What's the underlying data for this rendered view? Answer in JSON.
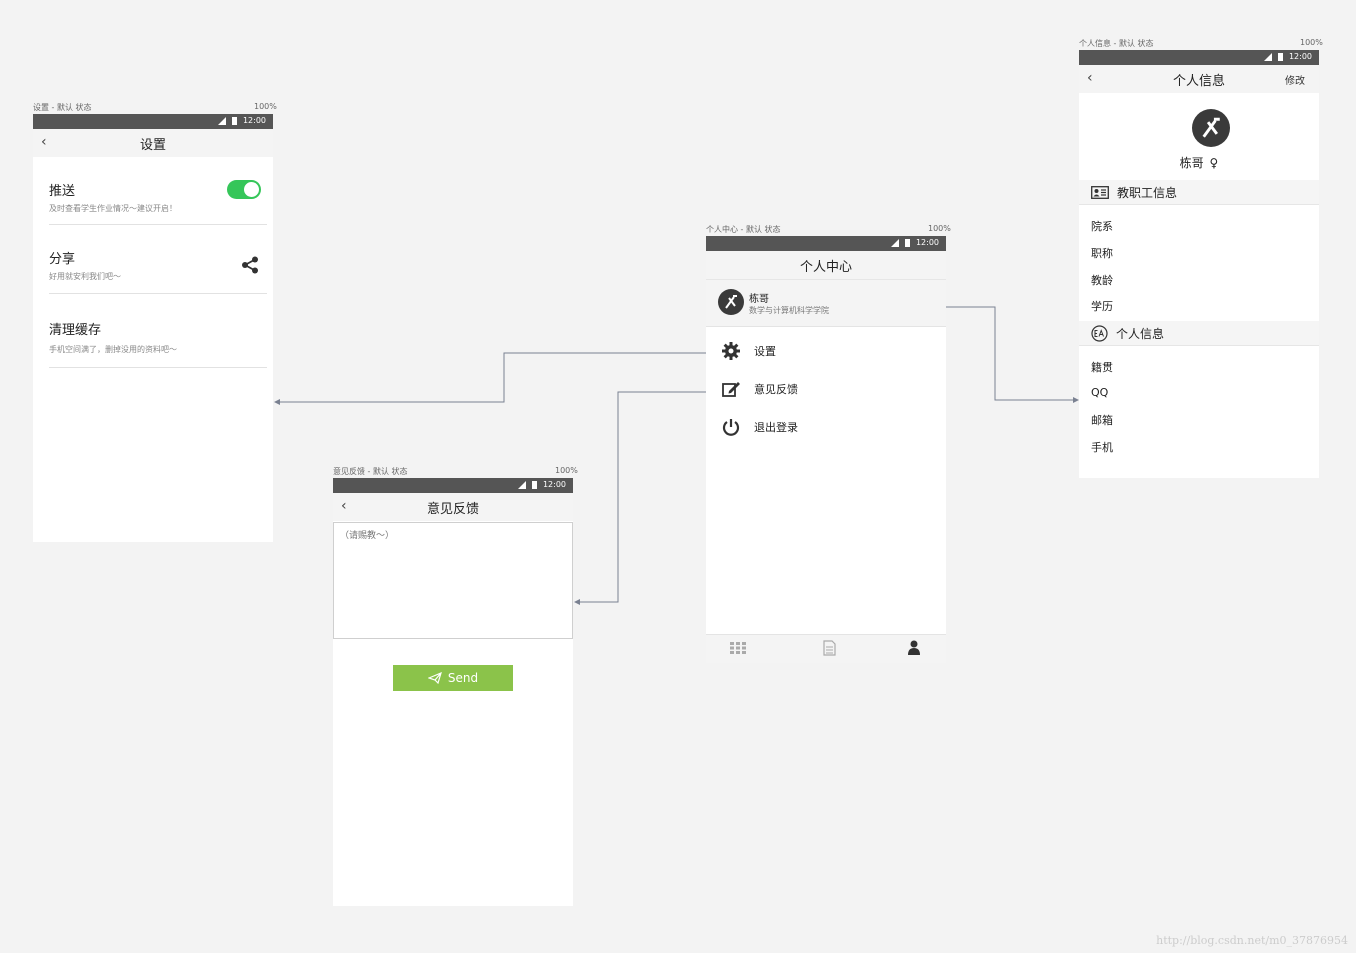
{
  "settings_screen": {
    "caption": "设置 - 默认 状态",
    "zoom": "100%",
    "time": "12:00",
    "title": "设置",
    "items": [
      {
        "title": "推送",
        "subtitle": "及时查看学生作业情况～建议开启！",
        "control": "toggle-on"
      },
      {
        "title": "分享",
        "subtitle": "好用就安利我们吧～",
        "control": "share-icon"
      },
      {
        "title": "清理缓存",
        "subtitle": "手机空间满了，删掉没用的资料吧～",
        "control": "none"
      }
    ]
  },
  "feedback_screen": {
    "caption": "意见反馈 - 默认 状态",
    "zoom": "100%",
    "time": "12:00",
    "title": "意见反馈",
    "textarea_placeholder": "（请赐教～）",
    "send_label": "Send"
  },
  "center_screen": {
    "caption": "个人中心 - 默认 状态",
    "zoom": "100%",
    "time": "12:00",
    "title": "个人中心",
    "user_name": "栋哥",
    "user_dept": "数学与计算机科学学院",
    "menu": [
      {
        "label": "设置",
        "icon": "gear-icon"
      },
      {
        "label": "意见反馈",
        "icon": "edit-icon"
      },
      {
        "label": "退出登录",
        "icon": "power-icon"
      }
    ],
    "tabbar": [
      "grid-icon",
      "document-icon",
      "user-icon"
    ]
  },
  "profile_screen": {
    "caption": "个人信息 - 默认 状态",
    "zoom": "100%",
    "time": "12:00",
    "title": "个人信息",
    "edit_label": "修改",
    "name": "栋哥",
    "gender_symbol": "♀",
    "section1": "教职工信息",
    "section1_rows": [
      "院系",
      "职称",
      "教龄",
      "学历"
    ],
    "section2": "个人信息",
    "section2_rows": [
      "籍贯",
      "QQ",
      "邮箱",
      "手机"
    ]
  },
  "watermark": "http://blog.csdn.net/m0_37876954",
  "colors": {
    "background": "#f3f3f3",
    "statusbar": "#555555",
    "toggle_on": "#35c659",
    "send_button": "#8bc34a",
    "connector": "#7a8191"
  }
}
